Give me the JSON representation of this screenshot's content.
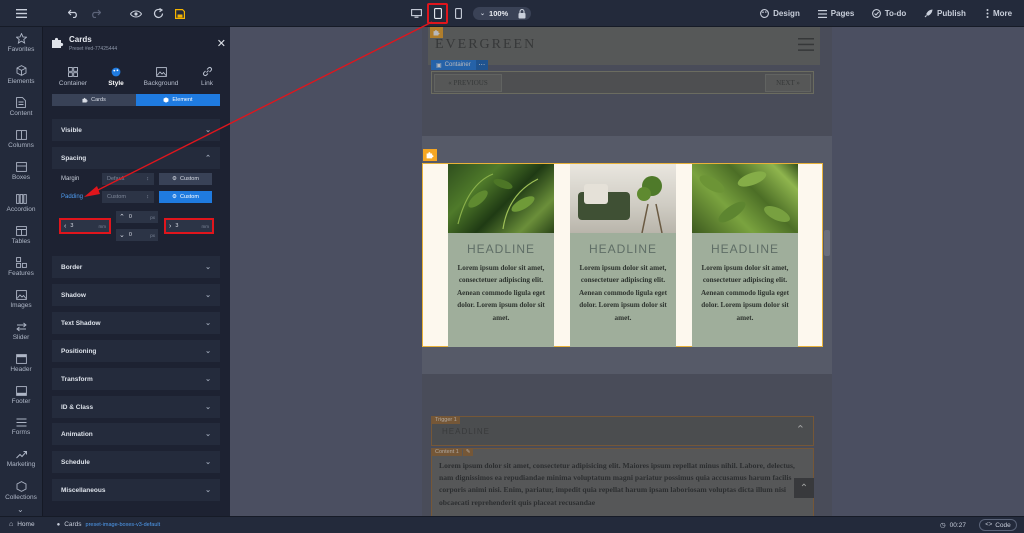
{
  "topbar": {
    "zoom": "100%",
    "right_items": [
      "Design",
      "Pages",
      "To-do",
      "Publish",
      "More"
    ]
  },
  "leftnav": {
    "items": [
      "Favorites",
      "Elements",
      "Content",
      "Columns",
      "Boxes",
      "Accordion",
      "Tables",
      "Features",
      "Images",
      "Slider",
      "Header",
      "Footer",
      "Forms",
      "Marketing",
      "Collections"
    ]
  },
  "panel": {
    "title": "Cards",
    "subtitle": "Preset #ed-77425444",
    "tabs": [
      "Container",
      "Style",
      "Background",
      "Link"
    ],
    "segment": [
      "Cards",
      "Element"
    ],
    "sections": {
      "visible": "Visible",
      "spacing": "Spacing",
      "border": "Border",
      "shadow": "Shadow",
      "text_shadow": "Text Shadow",
      "positioning": "Positioning",
      "transform": "Transform",
      "id_class": "ID & Class",
      "animation": "Animation",
      "schedule": "Schedule",
      "misc": "Miscellaneous"
    },
    "margin_label": "Margin",
    "margin_value": "Default",
    "padding_label": "Padding",
    "padding_value": "Custom",
    "custom_label": "Custom",
    "padding_left": "3",
    "padding_right": "3",
    "padding_top": "0",
    "padding_bottom": "0",
    "unit_mm": "mm",
    "unit_px": "px"
  },
  "site": {
    "logo": "EVERGREEN",
    "container_label": "Container",
    "prev_label": "« PREVIOUS",
    "next_label": "NEXT »",
    "cards": [
      {
        "headline": "HEADLINE",
        "body": "Lorem ipsum dolor sit amet, consectetuer adipiscing elit. Aenean commodo ligula eget dolor. Lorem ipsum dolor sit amet."
      },
      {
        "headline": "HEADLINE",
        "body": "Lorem ipsum dolor sit amet, consectetuer adipiscing elit. Aenean commodo ligula eget dolor. Lorem ipsum dolor sit amet."
      },
      {
        "headline": "HEADLINE",
        "body": "Lorem ipsum dolor sit amet, consectetuer adipiscing elit. Aenean commodo ligula eget dolor. Lorem ipsum dolor sit amet."
      }
    ],
    "trigger_tag": "Trigger 1",
    "content_tag": "Content 1",
    "accordion_headline": "HEADLINE",
    "accordion_text": "Lorem ipsum dolor sit amet, consectetur adipisicing elit. Maiores ipsum repellat minus nihil. Labore, delectus, nam dignissimos ea repudiandae minima voluptatum magni pariatur possimus quia accusamus harum facilis corporis animi nisi. Enim, pariatur, impedit quia repellat harum ipsam laboriosam voluptas dicta illum nisi obcaecati reprehenderit quis placeat recusandae"
  },
  "statusbar": {
    "home": "Home",
    "crumb": "Cards",
    "preset": "preset-image-boxes-v3-default",
    "time": "00:27",
    "code": "Code"
  }
}
